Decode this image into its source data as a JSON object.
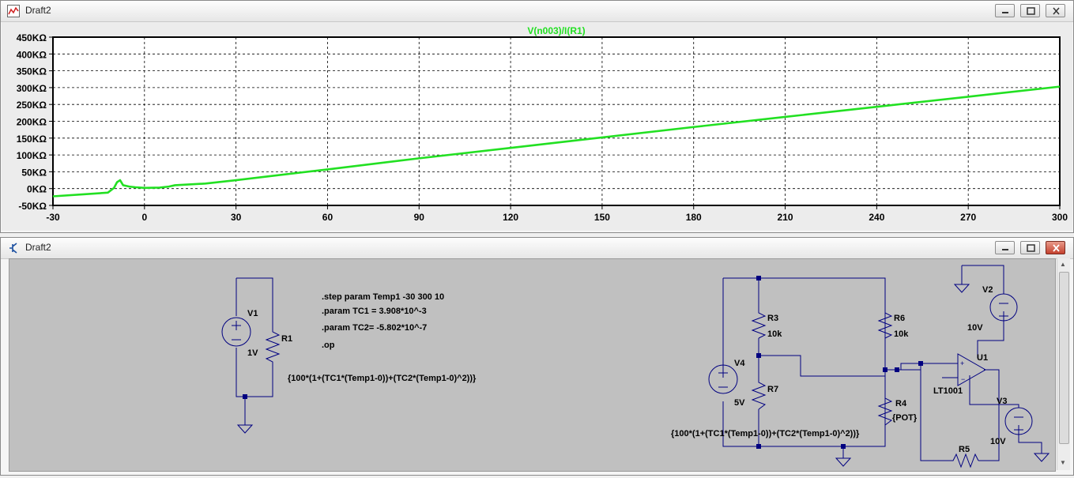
{
  "plot_window": {
    "title": "Draft2",
    "trace_label": "V(n003)/I(R1)"
  },
  "chart_data": {
    "type": "line",
    "title": "V(n003)/I(R1)",
    "x_ticks": [
      "-30",
      "0",
      "30",
      "60",
      "90",
      "120",
      "150",
      "180",
      "210",
      "240",
      "270",
      "300"
    ],
    "y_ticks": [
      "450KΩ",
      "400KΩ",
      "350KΩ",
      "300KΩ",
      "250KΩ",
      "200KΩ",
      "150KΩ",
      "100KΩ",
      "50KΩ",
      "0KΩ",
      "-50KΩ"
    ],
    "xlim": [
      -30,
      300
    ],
    "ylim": [
      -50,
      450
    ],
    "grid": true,
    "series": [
      {
        "name": "V(n003)/I(R1)",
        "color": "#22e022",
        "x": [
          -30,
          -20,
          -12,
          -10,
          -9,
          -8,
          -7,
          -6,
          -5,
          -3,
          0,
          5,
          8,
          10,
          20,
          30,
          60,
          90,
          120,
          150,
          180,
          210,
          240,
          270,
          300
        ],
        "y": [
          -23,
          -17,
          -12,
          2,
          19,
          25,
          10,
          8,
          6,
          4,
          2,
          3,
          6,
          10,
          15,
          25,
          57,
          90,
          121,
          152,
          183,
          213,
          243,
          273,
          303
        ]
      }
    ]
  },
  "schematic_window": {
    "title": "Draft2",
    "directives": [
      ".step param Temp1 -30 300 10",
      ".param TC1 = 3.908*10^-3",
      ".param TC2= -5.802*10^-7",
      ".op"
    ],
    "expr_left": "{100*(1+(TC1*(Temp1-0))+(TC2*(Temp1-0)^2))}",
    "expr_right": "{100*(1+(TC1*(Temp1-0))+(TC2*(Temp1-0)^2))}",
    "labels": {
      "v1": "V1",
      "v1_val": "1V",
      "r1": "R1",
      "r3": "R3",
      "r3_val": "10k",
      "r6": "R6",
      "r6_val": "10k",
      "v4": "V4",
      "v4_val": "5V",
      "r7": "R7",
      "r4": "R4",
      "r4_val": "{POT}",
      "v2": "V2",
      "v2_val": "10V",
      "v3": "V3",
      "v3_val": "10V",
      "u1": "U1",
      "u1_model": "LT1001",
      "r5": "R5"
    }
  },
  "colors": {
    "wire": "#000080",
    "trace": "#22e022",
    "schematic_bg": "#c0c0c0",
    "plot_bg": "#ffffff"
  }
}
